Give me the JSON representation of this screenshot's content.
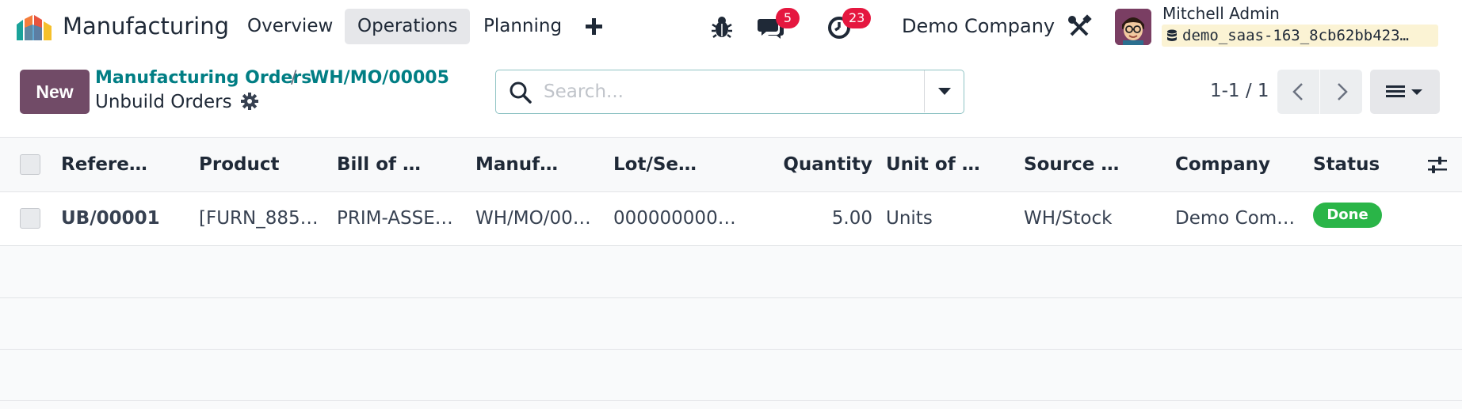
{
  "nav": {
    "app_name": "Manufacturing",
    "menu": [
      "Overview",
      "Operations",
      "Planning"
    ],
    "active_menu": "Operations",
    "messages_count": "5",
    "activities_count": "23",
    "company": "Demo Company",
    "user_name": "Mitchell Admin",
    "database": "demo_saas-163_8cb62bb423…"
  },
  "control": {
    "new_label": "New",
    "breadcrumb": [
      "Manufacturing Orders",
      "WH/MO/00005"
    ],
    "breadcrumb_sep": "/",
    "title": "Unbuild Orders",
    "search_placeholder": "Search...",
    "pager": "1-1 / 1"
  },
  "table": {
    "columns": [
      "Refere…",
      "Product",
      "Bill of …",
      "Manuf…",
      "Lot/Se…",
      "Quantity",
      "Unit of …",
      "Source …",
      "Company",
      "Status"
    ],
    "rows": [
      {
        "reference": "UB/00001",
        "product": "[FURN_885…",
        "bom": "PRIM-ASSE…",
        "mo": "WH/MO/00…",
        "lot": "000000000…",
        "quantity": "5.00",
        "uom": "Units",
        "source": "WH/Stock",
        "company": "Demo Com…",
        "status": "Done"
      }
    ]
  },
  "colors": {
    "primary": "#714b67",
    "link": "#017e84",
    "badge": "#e5173f",
    "done": "#2ab548"
  }
}
